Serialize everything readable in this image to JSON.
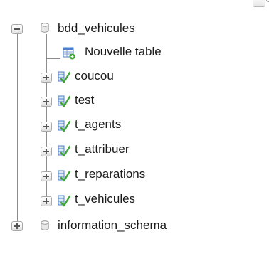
{
  "tree": {
    "databases": [
      {
        "name": "bdd_vehicules",
        "expanded": true,
        "new_table_label": "Nouvelle table",
        "tables": [
          "coucou",
          "test",
          "t_agents",
          "t_attribuer",
          "t_reparations",
          "t_vehicules"
        ]
      },
      {
        "name": "information_schema",
        "expanded": false
      }
    ]
  },
  "icons": {
    "database": "database-icon",
    "table": "table-icon",
    "new_table": "new-table-icon",
    "expand": "expand-icon",
    "collapse": "collapse-icon"
  },
  "colors": {
    "table_icon_blue": "#4a7fc9",
    "table_icon_green": "#3fa535",
    "connector": "#8c8c8c"
  }
}
